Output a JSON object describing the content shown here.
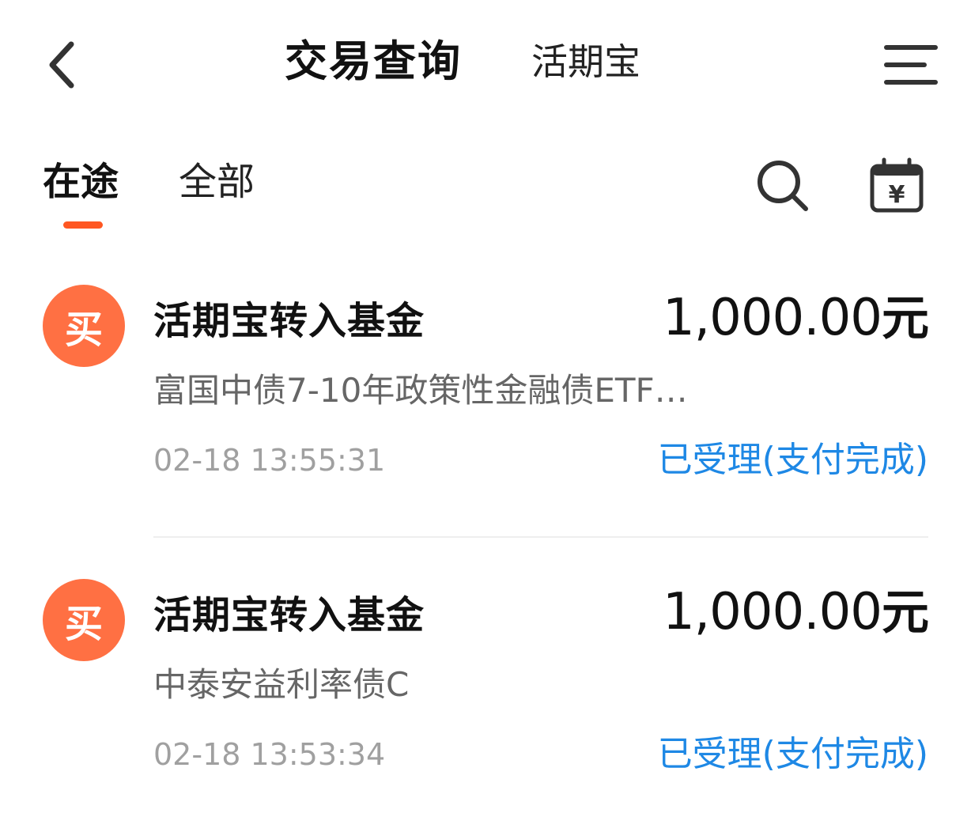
{
  "header": {
    "title": "交易查询",
    "subtitle": "活期宝"
  },
  "tabs": [
    {
      "label": "在途",
      "active": true
    },
    {
      "label": "全部",
      "active": false
    }
  ],
  "icons": {
    "back": "chevron-left-icon",
    "menu": "menu-icon",
    "search": "search-icon",
    "calendar": "calendar-yen-icon",
    "calendar_glyph": "¥"
  },
  "colors": {
    "accent": "#ff5722",
    "badge": "#ff7043",
    "status": "#1e88e5",
    "text": "#111111",
    "secondary": "#666666",
    "muted": "#a0a0a0"
  },
  "transactions": [
    {
      "badge": "买",
      "title": "活期宝转入基金",
      "amount": "1,000.00",
      "unit": "元",
      "fund": "富国中债7-10年政策性金融债ETF…",
      "time": "02-18 13:55:31",
      "status": "已受理(支付完成)"
    },
    {
      "badge": "买",
      "title": "活期宝转入基金",
      "amount": "1,000.00",
      "unit": "元",
      "fund": "中泰安益利率债C",
      "time": "02-18 13:53:34",
      "status": "已受理(支付完成)"
    }
  ]
}
